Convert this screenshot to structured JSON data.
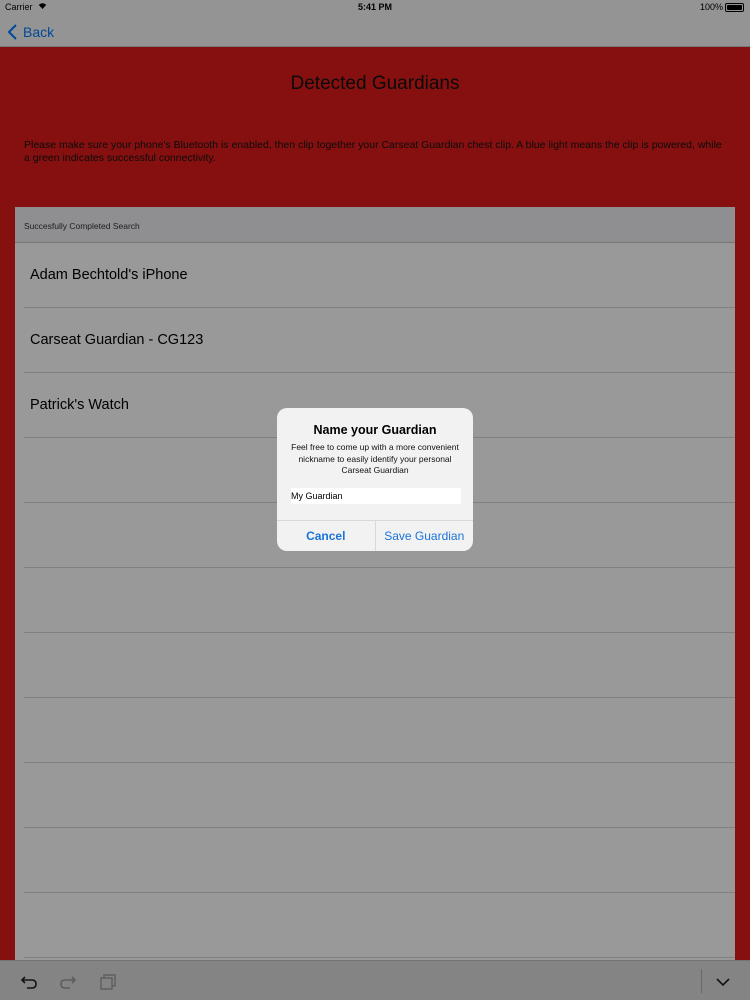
{
  "status_bar": {
    "carrier": "Carrier",
    "time": "5:41 PM",
    "battery": "100%",
    "icons": [
      "wifi-icon",
      "battery-icon"
    ]
  },
  "nav": {
    "back_label": "Back",
    "back_icon": "chevron-left-icon"
  },
  "page": {
    "title": "Detected Guardians",
    "instructions": "Please make sure your phone's Bluetooth is enabled, then clip together your Carseat Guardian chest clip. A blue light means the clip is powered, while a green indicates successful connectivity."
  },
  "table": {
    "header": "Succesfully Completed Search",
    "rows": [
      "Adam Bechtold's iPhone",
      "Carseat Guardian - CG123",
      "Patrick's Watch"
    ]
  },
  "alert": {
    "title": "Name your Guardian",
    "message": "Feel free to come up with a more convenient nickname to easily identify your personal Carseat Guardian",
    "input_value": "My Guardian",
    "cancel_label": "Cancel",
    "save_label": "Save Guardian"
  },
  "toolbar": {
    "icons": [
      "undo-icon",
      "redo-icon",
      "paste-icon",
      "chevron-down-icon"
    ]
  },
  "colors": {
    "accent_red": "#e01b1b",
    "ios_blue": "#007aff",
    "alert_button_blue": "#1a73d8"
  }
}
